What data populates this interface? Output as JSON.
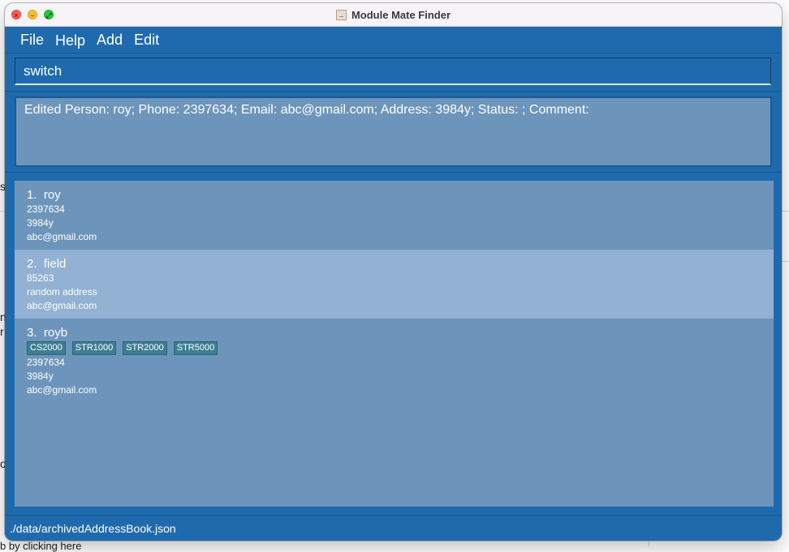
{
  "window": {
    "title": "Module Mate Finder"
  },
  "menu": {
    "file": "File",
    "help": "Help",
    "add": "Add",
    "edit": "Edit"
  },
  "command": {
    "value": "switch"
  },
  "result": {
    "message": "Edited Person: roy; Phone: 2397634; Email: abc@gmail.com; Address: 3984y; Status: ; Comment:"
  },
  "persons": [
    {
      "index": "1.",
      "name": "roy",
      "tags": [],
      "phone": "2397634",
      "address": "3984y",
      "email": "abc@gmail.com"
    },
    {
      "index": "2.",
      "name": "field",
      "tags": [],
      "phone": "85263",
      "address": "random address",
      "email": "abc@gmail.com"
    },
    {
      "index": "3.",
      "name": "royb",
      "tags": [
        "CS2000",
        "STR1000",
        "STR2000",
        "STR5000"
      ],
      "phone": "2397634",
      "address": "3984y",
      "email": "abc@gmail.com"
    }
  ],
  "status": {
    "path": "./data/archivedAddressBook.json"
  },
  "background": {
    "frag1": "s",
    "frag2": "n",
    "frag3": "r",
    "frag4": "o",
    "bottom_text": "b by clicking here"
  },
  "colors": {
    "primary": "#1f6aad",
    "panel": "#6d95bc",
    "selected_card": "#92b1d3",
    "tag": "#3e7e93"
  }
}
